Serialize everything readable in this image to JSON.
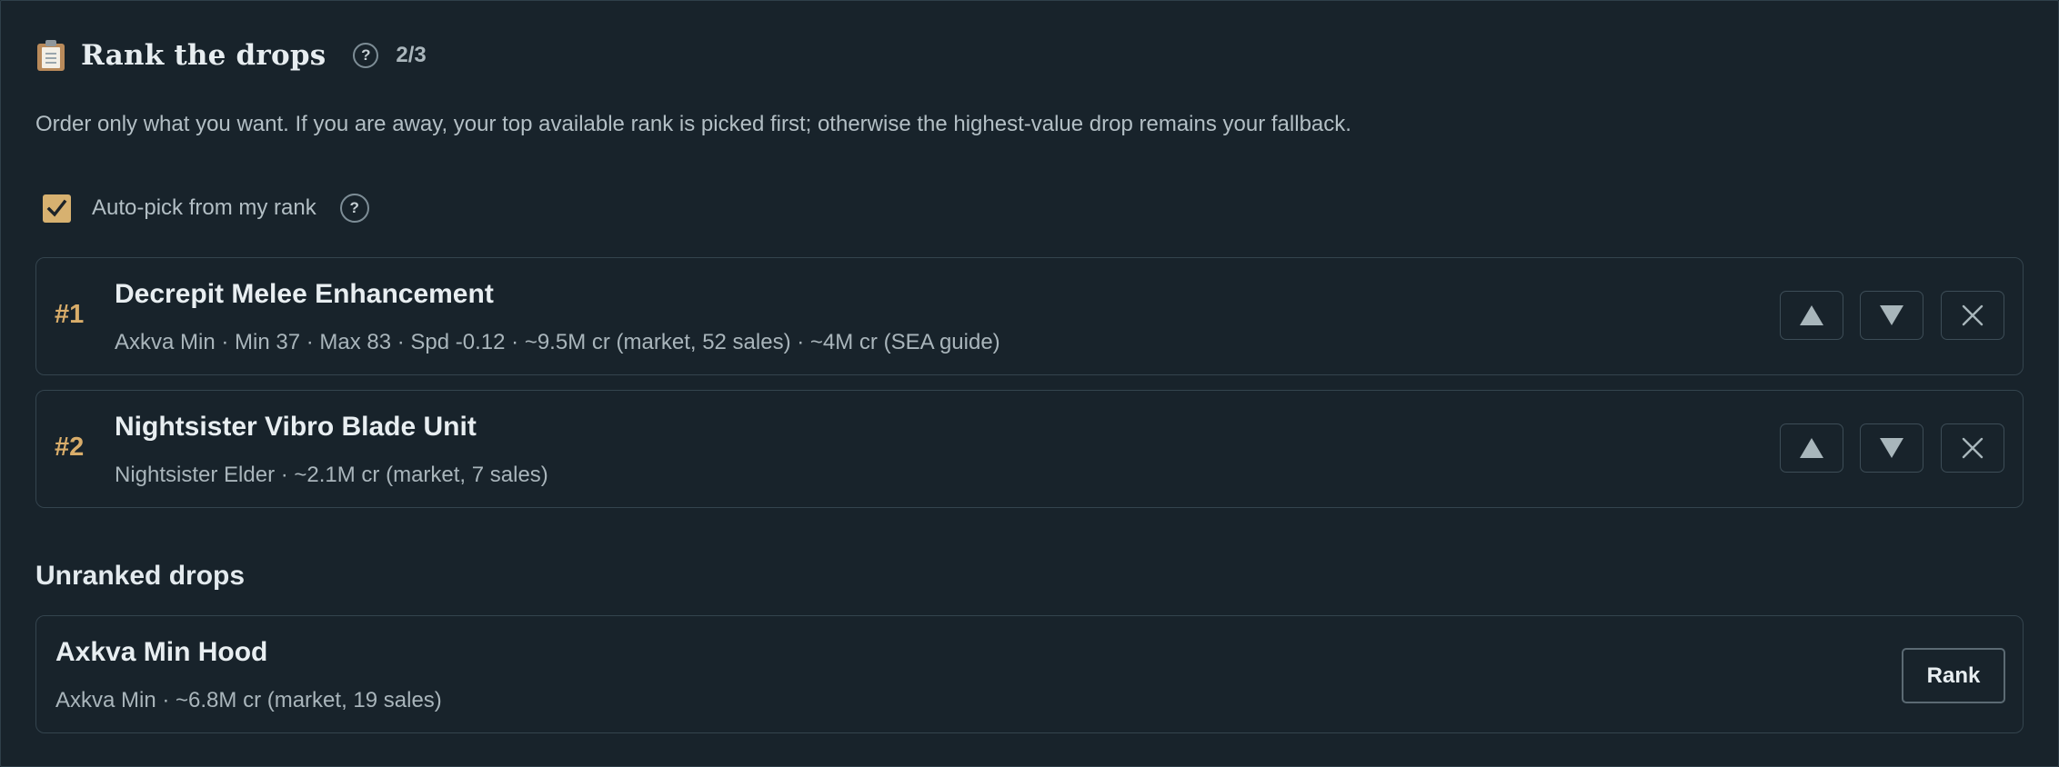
{
  "header": {
    "icon": "clipboard-icon",
    "title": "Rank the drops",
    "help_label": "?",
    "progress": "2/3"
  },
  "description": "Order only what you want. If you are away, your top available rank is picked first; otherwise the highest-value drop remains your fallback.",
  "autopick": {
    "label": "Auto-pick from my rank",
    "checked": true,
    "help_label": "?"
  },
  "ranked": [
    {
      "rank": "#1",
      "title": "Decrepit Melee Enhancement",
      "details": "Axkva Min · Min 37 · Max 83 · Spd -0.12 · ~9.5M cr (market, 52 sales) · ~4M cr (SEA guide)"
    },
    {
      "rank": "#2",
      "title": "Nightsister Vibro Blade Unit",
      "details": "Nightsister Elder · ~2.1M cr (market, 7 sales)"
    }
  ],
  "unranked": {
    "section_title": "Unranked drops",
    "items": [
      {
        "title": "Axkva Min Hood",
        "details": "Axkva Min · ~6.8M cr (market, 19 sales)",
        "button_label": "Rank"
      }
    ]
  },
  "colors": {
    "background": "#18232b",
    "accent": "#d7b170",
    "rank_number": "#d9ad6a",
    "border": "#34444e"
  }
}
